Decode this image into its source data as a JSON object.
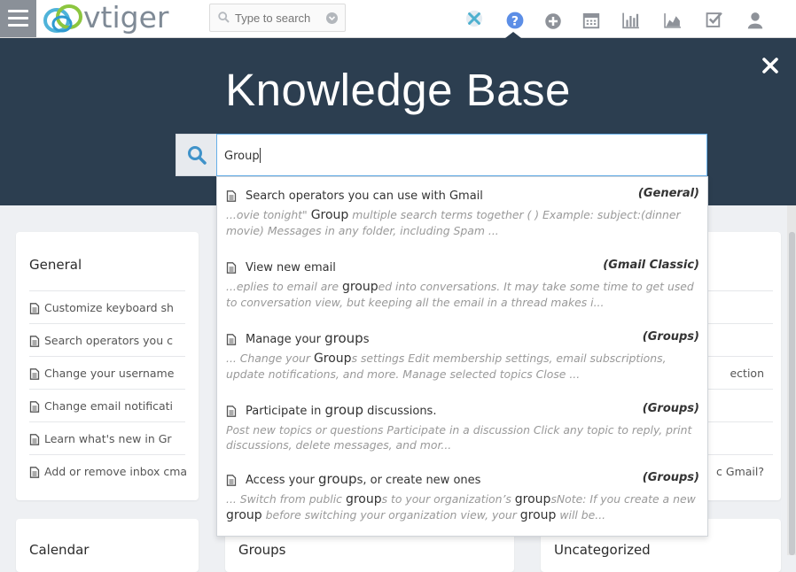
{
  "app": {
    "logo_text": "vtiger",
    "search_placeholder": "Type to search"
  },
  "toolbar_icons": [
    "vtiger-x-icon",
    "help-icon",
    "add-icon",
    "calendar-icon",
    "reports-icon",
    "charts-icon",
    "tasks-icon",
    "user-icon"
  ],
  "kb": {
    "title": "Knowledge Base",
    "query": "Group"
  },
  "results": [
    {
      "title_before": "Search operators you can use with Gmail",
      "title_match": "",
      "title_after": "",
      "category": "(General)",
      "snippet_before": "...ovie tonight\" ",
      "snippet_match": "Group",
      "snippet_after": " multiple search terms together ( ) Example: subject:(dinner movie) Messages in any folder, including Spam ..."
    },
    {
      "title_before": "View new email",
      "title_match": "",
      "title_after": "",
      "category": "(Gmail Classic)",
      "snippet_before": "...eplies to email are ",
      "snippet_match": "group",
      "snippet_after": "ed into conversations. It may take some time to get used to conversation view, but keeping all the email in a thread makes i..."
    },
    {
      "title_before": "Manage your ",
      "title_match": "group",
      "title_after": "s",
      "category": "(Groups)",
      "snippet_before": "... Change your ",
      "snippet_match": "Group",
      "snippet_after": "s settings  Edit membership settings, email subscriptions, update notifications, and more. Manage selected topics  Close ..."
    },
    {
      "title_before": "Participate in ",
      "title_match": "group",
      "title_after": " discussions.",
      "category": "(Groups)",
      "snippet_before": "Post new topics or questions Participate in a discussion  Click any topic to reply, print discussions, delete messages, and mor...",
      "snippet_match": "",
      "snippet_after": ""
    },
    {
      "title_before": "Access your ",
      "title_match": "group",
      "title_after": "s, or create new ones",
      "category": "(Groups)",
      "snippet_before": "... Switch from public ",
      "snippet_match": "group",
      "snippet_after": "s to your organization’s ",
      "snippet_match2": "group",
      "snippet_after2": "sNote: If you create a new ",
      "snippet_match3": "group",
      "snippet_after3": " before switching your organization view, your ",
      "snippet_match4": "group",
      "snippet_after4": " will be..."
    }
  ],
  "cards": {
    "general": {
      "title": "General",
      "items": [
        "Customize keyboard sh",
        "Search operators you c",
        "Change your username",
        "Change email notificati",
        "Learn what's new in Gr",
        "Add or remove inbox cmail"
      ]
    },
    "right_items": [
      "ection",
      "c Gmail?"
    ],
    "calendar_title": "Calendar",
    "groups_title": "Groups",
    "uncategorized_title": "Uncategorized"
  }
}
